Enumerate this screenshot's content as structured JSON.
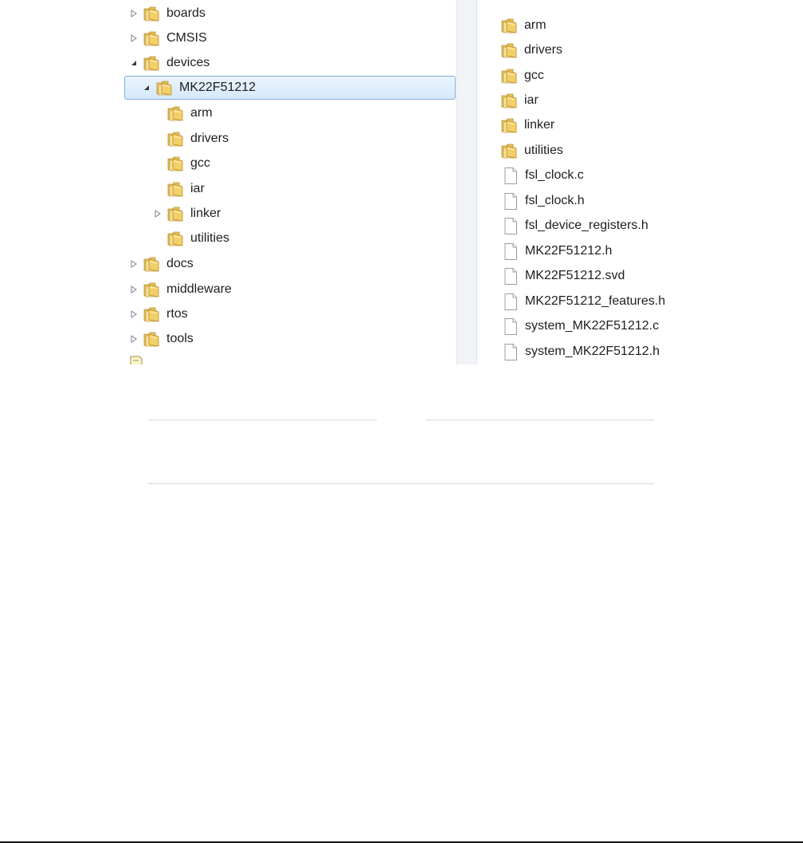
{
  "tree": {
    "items": [
      {
        "label": "boards",
        "state": "collapsed"
      },
      {
        "label": "CMSIS",
        "state": "collapsed"
      },
      {
        "label": "devices",
        "state": "expanded"
      },
      {
        "label": "MK22F51212",
        "state": "expanded",
        "selected": true
      },
      {
        "label": "arm",
        "state": "leaf"
      },
      {
        "label": "drivers",
        "state": "leaf"
      },
      {
        "label": "gcc",
        "state": "leaf"
      },
      {
        "label": "iar",
        "state": "leaf"
      },
      {
        "label": "linker",
        "state": "collapsed"
      },
      {
        "label": "utilities",
        "state": "leaf"
      },
      {
        "label": "docs",
        "state": "collapsed"
      },
      {
        "label": "middleware",
        "state": "collapsed"
      },
      {
        "label": "rtos",
        "state": "collapsed"
      },
      {
        "label": "tools",
        "state": "collapsed"
      },
      {
        "label": "",
        "state": "partial"
      }
    ]
  },
  "files": {
    "items": [
      {
        "label": "arm",
        "type": "folder"
      },
      {
        "label": "drivers",
        "type": "folder"
      },
      {
        "label": "gcc",
        "type": "folder"
      },
      {
        "label": "iar",
        "type": "folder"
      },
      {
        "label": "linker",
        "type": "folder"
      },
      {
        "label": "utilities",
        "type": "folder"
      },
      {
        "label": "fsl_clock.c",
        "type": "file"
      },
      {
        "label": "fsl_clock.h",
        "type": "file"
      },
      {
        "label": "fsl_device_registers.h",
        "type": "file"
      },
      {
        "label": "MK22F51212.h",
        "type": "file"
      },
      {
        "label": "MK22F51212.svd",
        "type": "file"
      },
      {
        "label": "MK22F51212_features.h",
        "type": "file"
      },
      {
        "label": "system_MK22F51212.c",
        "type": "file"
      },
      {
        "label": "system_MK22F51212.h",
        "type": "file"
      }
    ]
  },
  "colors": {
    "selection_border": "#84acdd",
    "selection_fill": "#d6e9fb",
    "folder_light": "#f4d77b",
    "folder_dark": "#d9a93a",
    "divider": "#f1f3f6"
  },
  "icons": {
    "collapsed": "triangle-right-icon",
    "expanded": "triangle-down-icon",
    "folder": "folder-icon",
    "file": "file-icon"
  }
}
